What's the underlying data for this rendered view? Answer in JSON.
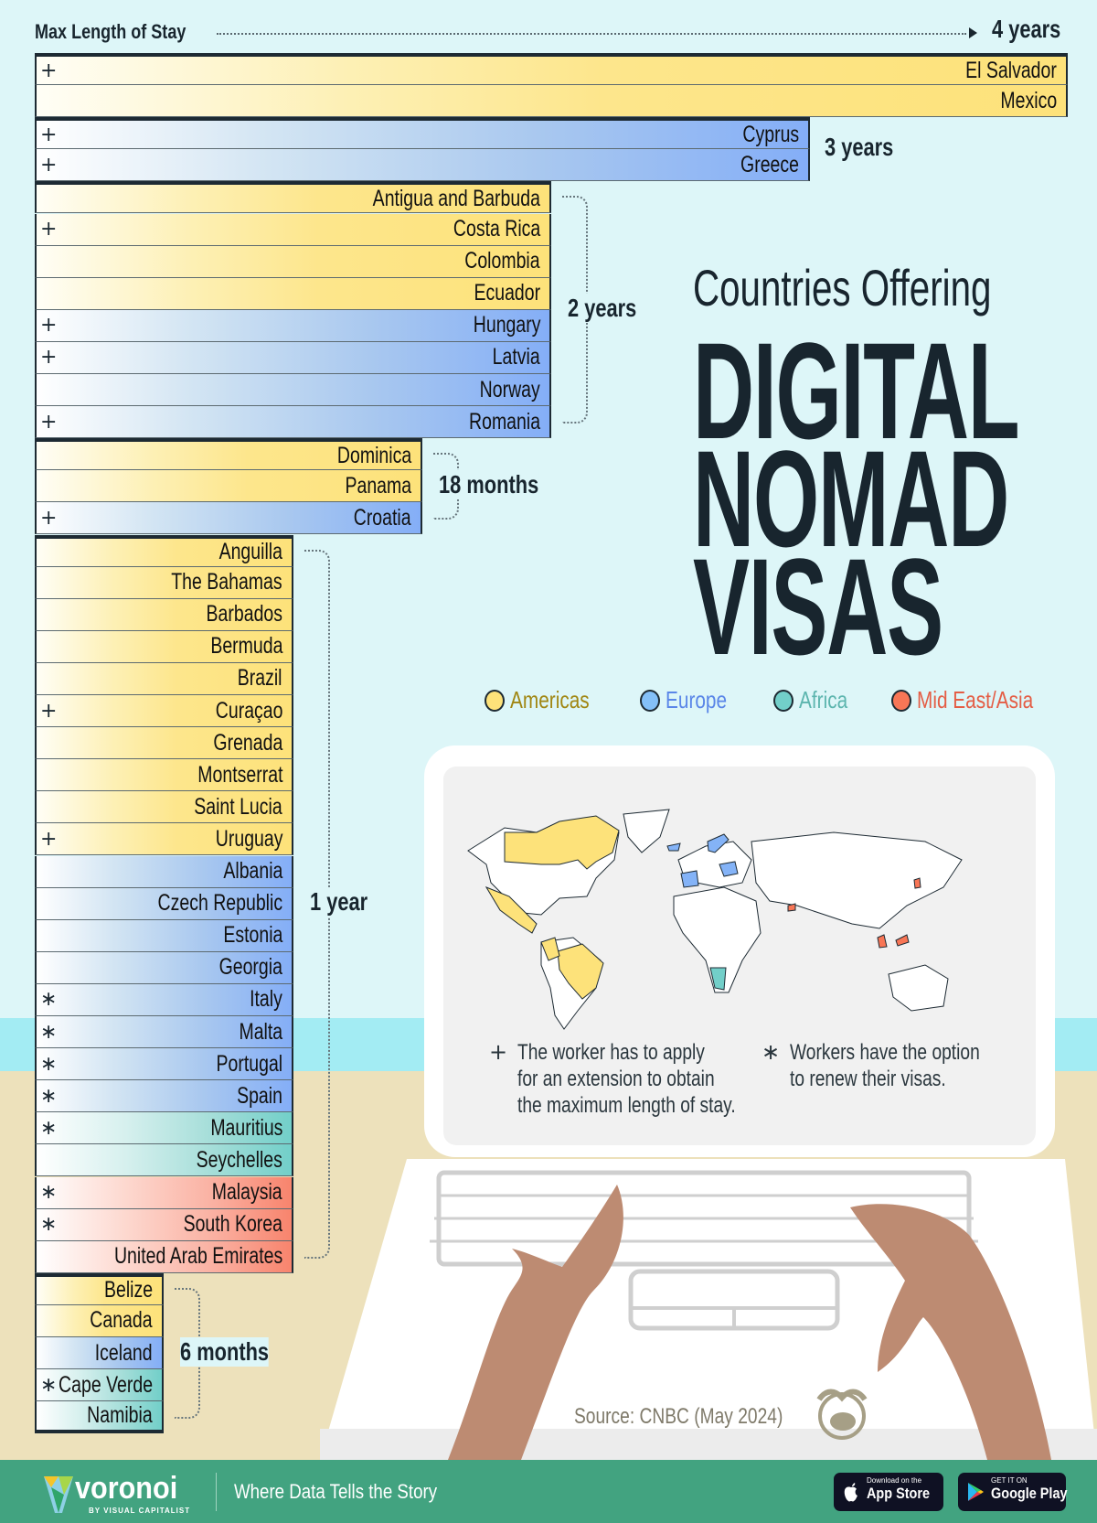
{
  "chart_data": {
    "type": "bar",
    "orientation": "horizontal",
    "title": "Countries Offering Digital Nomad Visas",
    "subtitle": "Countries Offering",
    "title_lines": [
      "DIGITAL",
      "NOMAD",
      "VISAS"
    ],
    "xlabel": "Max Length of Stay",
    "x_max_label": "4 years",
    "unit": "months",
    "xlim": [
      0,
      48
    ],
    "legend": [
      {
        "region": "Americas",
        "color": "#fde27a",
        "text_color": "#a08612"
      },
      {
        "region": "Europe",
        "color": "#84b3f7",
        "text_color": "#5a86e8"
      },
      {
        "region": "Africa",
        "color": "#72cfc9",
        "text_color": "#5cb5ae"
      },
      {
        "region": "Mid East/Asia",
        "color": "#f8846d",
        "text_color": "#e45d45"
      }
    ],
    "groups": [
      {
        "label": "4 years",
        "months": 48,
        "countries": [
          {
            "name": "El Salvador",
            "region": "Americas",
            "mark": "+"
          },
          {
            "name": "Mexico",
            "region": "Americas",
            "mark": ""
          }
        ]
      },
      {
        "label": "3 years",
        "months": 36,
        "countries": [
          {
            "name": "Cyprus",
            "region": "Europe",
            "mark": "+"
          },
          {
            "name": "Greece",
            "region": "Europe",
            "mark": "+"
          }
        ]
      },
      {
        "label": "2 years",
        "months": 24,
        "countries": [
          {
            "name": "Antigua and Barbuda",
            "region": "Americas",
            "mark": ""
          },
          {
            "name": "Costa Rica",
            "region": "Americas",
            "mark": "+"
          },
          {
            "name": "Colombia",
            "region": "Americas",
            "mark": ""
          },
          {
            "name": "Ecuador",
            "region": "Americas",
            "mark": ""
          },
          {
            "name": "Hungary",
            "region": "Europe",
            "mark": "+"
          },
          {
            "name": "Latvia",
            "region": "Europe",
            "mark": "+"
          },
          {
            "name": "Norway",
            "region": "Europe",
            "mark": ""
          },
          {
            "name": "Romania",
            "region": "Europe",
            "mark": "+"
          }
        ]
      },
      {
        "label": "18 months",
        "months": 18,
        "countries": [
          {
            "name": "Dominica",
            "region": "Americas",
            "mark": ""
          },
          {
            "name": "Panama",
            "region": "Americas",
            "mark": ""
          },
          {
            "name": "Croatia",
            "region": "Europe",
            "mark": "+"
          }
        ]
      },
      {
        "label": "1 year",
        "months": 12,
        "countries": [
          {
            "name": "Anguilla",
            "region": "Americas",
            "mark": ""
          },
          {
            "name": "The Bahamas",
            "region": "Americas",
            "mark": ""
          },
          {
            "name": "Barbados",
            "region": "Americas",
            "mark": ""
          },
          {
            "name": "Bermuda",
            "region": "Americas",
            "mark": ""
          },
          {
            "name": "Brazil",
            "region": "Americas",
            "mark": ""
          },
          {
            "name": "Curaçao",
            "region": "Americas",
            "mark": "+"
          },
          {
            "name": "Grenada",
            "region": "Americas",
            "mark": ""
          },
          {
            "name": "Montserrat",
            "region": "Americas",
            "mark": ""
          },
          {
            "name": "Saint Lucia",
            "region": "Americas",
            "mark": ""
          },
          {
            "name": "Uruguay",
            "region": "Americas",
            "mark": "+"
          },
          {
            "name": "Albania",
            "region": "Europe",
            "mark": ""
          },
          {
            "name": "Czech Republic",
            "region": "Europe",
            "mark": ""
          },
          {
            "name": "Estonia",
            "region": "Europe",
            "mark": ""
          },
          {
            "name": "Georgia",
            "region": "Europe",
            "mark": ""
          },
          {
            "name": "Italy",
            "region": "Europe",
            "mark": "*"
          },
          {
            "name": "Malta",
            "region": "Europe",
            "mark": "*"
          },
          {
            "name": "Portugal",
            "region": "Europe",
            "mark": "*"
          },
          {
            "name": "Spain",
            "region": "Europe",
            "mark": "*"
          },
          {
            "name": "Mauritius",
            "region": "Africa",
            "mark": "*"
          },
          {
            "name": "Seychelles",
            "region": "Africa",
            "mark": ""
          },
          {
            "name": "Malaysia",
            "region": "Mid East/Asia",
            "mark": "*"
          },
          {
            "name": "South Korea",
            "region": "Mid East/Asia",
            "mark": "*"
          },
          {
            "name": "United Arab Emirates",
            "region": "Mid East/Asia",
            "mark": ""
          }
        ]
      },
      {
        "label": "6 months",
        "months": 6,
        "countries": [
          {
            "name": "Belize",
            "region": "Americas",
            "mark": ""
          },
          {
            "name": "Canada",
            "region": "Americas",
            "mark": ""
          },
          {
            "name": "Iceland",
            "region": "Europe",
            "mark": ""
          },
          {
            "name": "Cape Verde",
            "region": "Africa",
            "mark": "*"
          },
          {
            "name": "Namibia",
            "region": "Africa",
            "mark": ""
          }
        ]
      }
    ]
  },
  "header": {
    "axis_title": "Max Length of Stay",
    "axis_max": "4 years",
    "subtitle": "Countries Offering",
    "title_lines": [
      "DIGITAL",
      "NOMAD",
      "VISAS"
    ]
  },
  "legend": {
    "items": [
      "Americas",
      "Europe",
      "Africa",
      "Mid East/Asia"
    ]
  },
  "notes": {
    "plus_symbol": "+",
    "plus_lines": [
      "The worker has to apply",
      "for an extension to obtain",
      "the maximum length of stay."
    ],
    "star_symbol": "∗",
    "star_lines": [
      "Workers have the option",
      "to renew their visas."
    ]
  },
  "source": "Source: CNBC (May 2024)",
  "footer": {
    "brand": "voronoi",
    "brand_sub": "BY VISUAL CAPITALIST",
    "tagline": "Where Data Tells the Story",
    "app_store_small": "Download on the",
    "app_store_big": "App Store",
    "google_play_small": "GET IT ON",
    "google_play_big": "Google Play"
  }
}
